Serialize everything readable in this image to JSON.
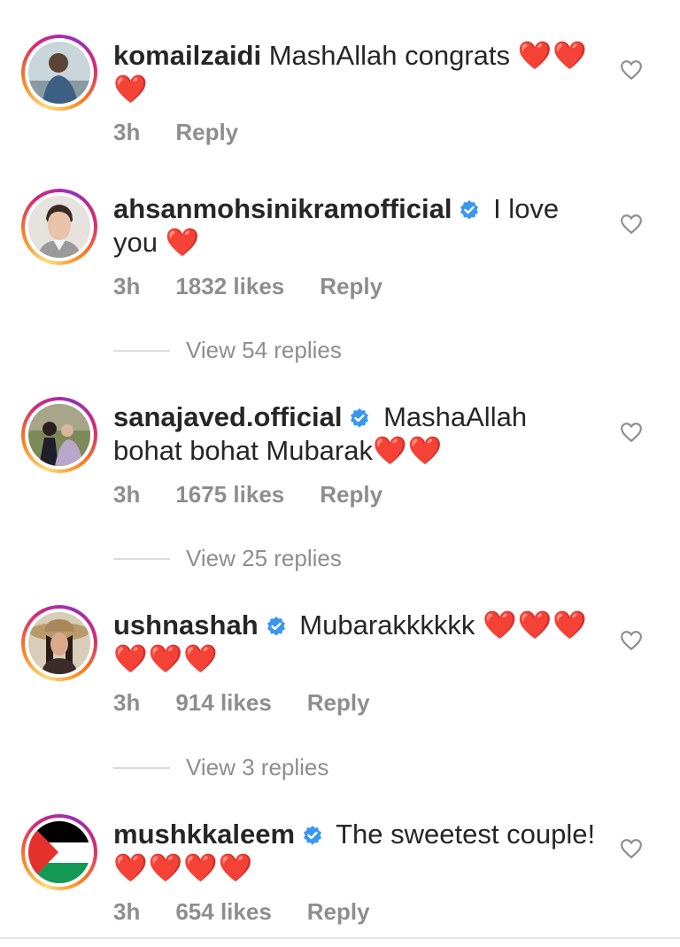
{
  "comments": [
    {
      "username": "komailzaidi",
      "verified": false,
      "text": "MashAllah congrats",
      "hearts": "❤️❤️ ❤️",
      "time": "3h",
      "likes": "",
      "reply_label": "Reply",
      "avatar_icon": "user-avatar-photo"
    },
    {
      "username": "ahsanmohsinikramofficial",
      "verified": true,
      "text": "I love you",
      "hearts": "❤️",
      "time": "3h",
      "likes": "1832 likes",
      "reply_label": "Reply",
      "view_replies": "View 54 replies",
      "avatar_icon": "user-avatar-photo"
    },
    {
      "username": "sanajaved.official",
      "verified": true,
      "text": "MashaAllah bohat bohat Mubarak",
      "hearts": "❤️❤️",
      "time": "3h",
      "likes": "1675 likes",
      "reply_label": "Reply",
      "view_replies": "View 25 replies",
      "avatar_icon": "user-avatar-photo"
    },
    {
      "username": "ushnashah",
      "verified": true,
      "text": "Mubarakkkkkk",
      "hearts": "❤️❤️❤️ ❤️❤️❤️",
      "time": "3h",
      "likes": "914 likes",
      "reply_label": "Reply",
      "view_replies": "View 3 replies",
      "avatar_icon": "user-avatar-photo"
    },
    {
      "username": "mushkkaleem",
      "verified": true,
      "text": "The sweetest couple!",
      "hearts": "❤️❤️❤️❤️",
      "time": "3h",
      "likes": "654 likes",
      "reply_label": "Reply",
      "avatar_icon": "palestine-flag-avatar"
    }
  ],
  "icons": {
    "like": "heart-outline-icon",
    "verified": "verified-badge-icon"
  },
  "colors": {
    "verified_blue": "#3897f0",
    "heart_red": "#e02424",
    "muted_text": "#8e8e8e"
  }
}
